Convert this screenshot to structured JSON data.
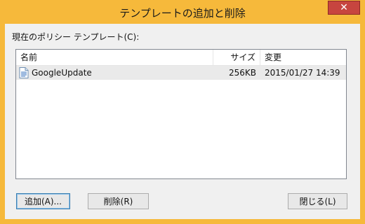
{
  "window": {
    "title": "テンプレートの追加と削除",
    "close_label": "✕"
  },
  "main": {
    "label": "現在のポリシー テンプレート(C):",
    "columns": {
      "name": "名前",
      "size": "サイズ",
      "modified": "変更"
    },
    "rows": [
      {
        "name": "GoogleUpdate",
        "size": "256KB",
        "modified": "2015/01/27 14:39"
      }
    ]
  },
  "buttons": {
    "add": "追加(A)...",
    "remove": "削除(R)",
    "close": "閉じる(L)"
  }
}
